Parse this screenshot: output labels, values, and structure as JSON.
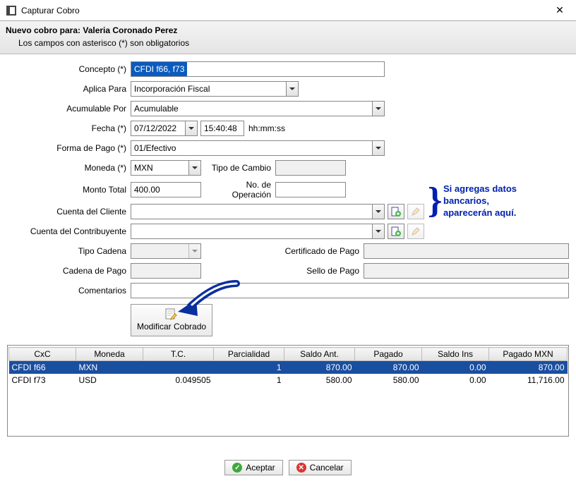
{
  "window": {
    "title": "Capturar Cobro",
    "subtitle": "Nuevo cobro para: Valeria Coronado Perez",
    "hint": "Los campos con asterisco (*) son obligatorios"
  },
  "labels": {
    "concepto": "Concepto (*)",
    "aplica_para": "Aplica Para",
    "acumulable_por": "Acumulable Por",
    "fecha": "Fecha (*)",
    "hhmmss": "hh:mm:ss",
    "forma_pago": "Forma de Pago (*)",
    "moneda": "Moneda (*)",
    "tipo_cambio": "Tipo de Cambio",
    "monto_total": "Monto Total",
    "no_operacion": "No. de Operación",
    "cuenta_cliente": "Cuenta del Cliente",
    "cuenta_contrib": "Cuenta del Contribuyente",
    "tipo_cadena": "Tipo Cadena",
    "cert_pago": "Certificado de Pago",
    "cadena_pago": "Cadena de Pago",
    "sello_pago": "Sello de Pago",
    "comentarios": "Comentarios"
  },
  "values": {
    "concepto": "CFDI f66, f73",
    "aplica_para": "Incorporación Fiscal",
    "acumulable_por": "Acumulable",
    "fecha": "07/12/2022",
    "hora": "15:40:48",
    "forma_pago": "01/Efectivo",
    "moneda": "MXN",
    "tipo_cambio": "",
    "monto_total": "400.00",
    "no_operacion": "",
    "cuenta_cliente": "",
    "cuenta_contrib": "",
    "tipo_cadena": "",
    "cert_pago": "",
    "cadena_pago": "",
    "sello_pago": "",
    "comentarios": ""
  },
  "buttons": {
    "modificar_cobrado": "Modificar Cobrado",
    "aceptar": "Aceptar",
    "cancelar": "Cancelar"
  },
  "annotation": {
    "line1": "Si agregas datos",
    "line2": "bancarios,",
    "line3": "aparecerán aquí."
  },
  "grid": {
    "headers": [
      "CxC",
      "Moneda",
      "T.C.",
      "Parcialidad",
      "Saldo Ant.",
      "Pagado",
      "Saldo Ins",
      "Pagado MXN"
    ],
    "rows": [
      {
        "cxc": "CFDI f66",
        "moneda": "MXN",
        "tc": "",
        "parc": "1",
        "sant": "870.00",
        "pag": "870.00",
        "sins": "0.00",
        "pmxn": "870.00",
        "selected": true
      },
      {
        "cxc": "CFDI f73",
        "moneda": "USD",
        "tc": "0.049505",
        "parc": "1",
        "sant": "580.00",
        "pag": "580.00",
        "sins": "0.00",
        "pmxn": "11,716.00",
        "selected": false
      }
    ]
  }
}
